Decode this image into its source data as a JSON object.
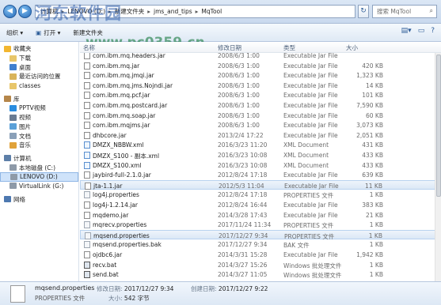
{
  "breadcrumb": [
    "计算机",
    "LENOVO (D:)",
    "新建文件夹",
    "jms_and_tips",
    "MqTool"
  ],
  "search": {
    "placeholder": "搜索 MqTool"
  },
  "toolbar": {
    "organize": "组织 ▾",
    "open": "打开 ▾",
    "new_folder": "新建文件夹"
  },
  "nav": {
    "items": [
      {
        "label": "收藏夹",
        "icon": "star-icon",
        "indent": 0
      },
      {
        "label": "下载",
        "icon": "download-folder-icon",
        "indent": 1
      },
      {
        "label": "桌面",
        "icon": "desktop-icon",
        "indent": 1
      },
      {
        "label": "最近访问的位置",
        "icon": "recent-places-icon",
        "indent": 1
      },
      {
        "label": "classes",
        "icon": "folder-icon",
        "indent": 1
      },
      {
        "label": "",
        "icon": "",
        "indent": 0
      },
      {
        "label": "库",
        "icon": "library-icon",
        "indent": 0
      },
      {
        "label": "PPTV视频",
        "icon": "pptv-icon",
        "indent": 1
      },
      {
        "label": "视频",
        "icon": "video-icon",
        "indent": 1
      },
      {
        "label": "图片",
        "icon": "picture-icon",
        "indent": 1
      },
      {
        "label": "文档",
        "icon": "document-icon",
        "indent": 1
      },
      {
        "label": "音乐",
        "icon": "music-icon",
        "indent": 1
      },
      {
        "label": "",
        "icon": "",
        "indent": 0
      },
      {
        "label": "计算机",
        "icon": "computer-icon",
        "indent": 0
      },
      {
        "label": "本地磁盘 (C:)",
        "icon": "drive-icon",
        "indent": 1
      },
      {
        "label": "LENOVO (D:)",
        "icon": "drive-icon",
        "indent": 1,
        "selected": true
      },
      {
        "label": "VirtualLink (G:)",
        "icon": "drive-icon",
        "indent": 1
      },
      {
        "label": "",
        "icon": "",
        "indent": 0
      },
      {
        "label": "网络",
        "icon": "network-icon",
        "indent": 0
      }
    ]
  },
  "columns": {
    "name": "名称",
    "date": "修改日期",
    "type": "类型",
    "size": "大小"
  },
  "files": [
    {
      "name": "com.ibm.mq.headers.jar",
      "date": "2008/6/3 1:00",
      "type": "Executable Jar File",
      "size": "",
      "kind": "jar"
    },
    {
      "name": "com.ibm.mq.jar",
      "date": "2008/6/3 1:00",
      "type": "Executable Jar File",
      "size": "420 KB",
      "kind": "jar"
    },
    {
      "name": "com.ibm.mq.jmqi.jar",
      "date": "2008/6/3 1:00",
      "type": "Executable Jar File",
      "size": "1,323 KB",
      "kind": "jar"
    },
    {
      "name": "com.ibm.mq.jms.Nojndi.jar",
      "date": "2008/6/3 1:00",
      "type": "Executable Jar File",
      "size": "14 KB",
      "kind": "jar"
    },
    {
      "name": "com.ibm.mq.pcf.jar",
      "date": "2008/6/3 1:00",
      "type": "Executable Jar File",
      "size": "101 KB",
      "kind": "jar"
    },
    {
      "name": "com.ibm.mq.postcard.jar",
      "date": "2008/6/3 1:00",
      "type": "Executable Jar File",
      "size": "7,590 KB",
      "kind": "jar"
    },
    {
      "name": "com.ibm.mq.soap.jar",
      "date": "2008/6/3 1:00",
      "type": "Executable Jar File",
      "size": "60 KB",
      "kind": "jar"
    },
    {
      "name": "com.ibm.mqjms.jar",
      "date": "2008/6/3 1:00",
      "type": "Executable Jar File",
      "size": "3,073 KB",
      "kind": "jar"
    },
    {
      "name": "dhbcore.jar",
      "date": "2013/2/4 17:22",
      "type": "Executable Jar File",
      "size": "2,051 KB",
      "kind": "jar"
    },
    {
      "name": "DMZX_NBBW.xml",
      "date": "2016/3/23 11:20",
      "type": "XML Document",
      "size": "431 KB",
      "kind": "xml"
    },
    {
      "name": "DMZX_S100 - 副本.xml",
      "date": "2016/3/23 10:08",
      "type": "XML Document",
      "size": "433 KB",
      "kind": "xml"
    },
    {
      "name": "DMZX_S100.xml",
      "date": "2016/3/23 10:08",
      "type": "XML Document",
      "size": "433 KB",
      "kind": "xml"
    },
    {
      "name": "jaybird-full-2.1.0.jar",
      "date": "2012/8/24 17:18",
      "type": "Executable Jar File",
      "size": "639 KB",
      "kind": "jar"
    },
    {
      "name": "jta-1.1.jar",
      "date": "2012/5/3 11:04",
      "type": "Executable Jar File",
      "size": "11 KB",
      "kind": "jar",
      "hover": true
    },
    {
      "name": "log4j.properties",
      "date": "2012/8/24 17:18",
      "type": "PROPERTIES 文件",
      "size": "1 KB",
      "kind": "prop"
    },
    {
      "name": "log4j-1.2.14.jar",
      "date": "2012/8/24 16:44",
      "type": "Executable Jar File",
      "size": "383 KB",
      "kind": "jar"
    },
    {
      "name": "mqdemo.jar",
      "date": "2014/3/28 17:43",
      "type": "Executable Jar File",
      "size": "21 KB",
      "kind": "jar"
    },
    {
      "name": "mqrecv.properties",
      "date": "2017/11/24 11:34",
      "type": "PROPERTIES 文件",
      "size": "1 KB",
      "kind": "prop"
    },
    {
      "name": "mqsend.properties",
      "date": "2017/12/27 9:34",
      "type": "PROPERTIES 文件",
      "size": "1 KB",
      "kind": "prop",
      "selected": true
    },
    {
      "name": "mqsend.properties.bak",
      "date": "2017/12/27 9:34",
      "type": "BAK 文件",
      "size": "1 KB",
      "kind": "prop"
    },
    {
      "name": "ojdbc6.jar",
      "date": "2014/3/31 15:28",
      "type": "Executable Jar File",
      "size": "1,942 KB",
      "kind": "jar"
    },
    {
      "name": "recv.bat",
      "date": "2014/3/27 15:26",
      "type": "Windows 批处理文件",
      "size": "1 KB",
      "kind": "bat"
    },
    {
      "name": "send.bat",
      "date": "2014/3/27 11:05",
      "type": "Windows 批处理文件",
      "size": "1 KB",
      "kind": "bat"
    }
  ],
  "details": {
    "filename": "mqsend.properties",
    "filetype": "PROPERTIES 文件",
    "modified_label": "修改日期:",
    "modified_value": "2017/12/27 9:34",
    "created_label": "创建日期:",
    "created_value": "2017/12/27 9:22",
    "size_label": "大小:",
    "size_value": "542 字节"
  },
  "watermark": {
    "line1": "河东软件园",
    "line2": "www.pc0359.cn"
  },
  "colors": {
    "selection": "#cfe3fa",
    "chrome": "#dbe7f5",
    "accent": "#2668b6"
  }
}
